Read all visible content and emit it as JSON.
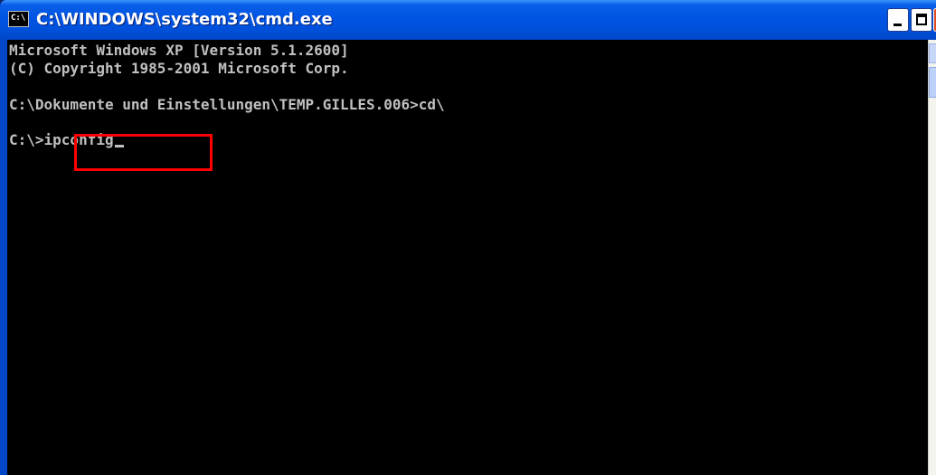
{
  "window": {
    "title": "C:\\WINDOWS\\system32\\cmd.exe",
    "icon_label": "C:\\"
  },
  "console": {
    "lines": [
      "Microsoft Windows XP [Version 5.1.2600]",
      "(C) Copyright 1985-2001 Microsoft Corp.",
      "",
      "C:\\Dokumente und Einstellungen\\TEMP.GILLES.006>cd\\",
      "",
      "C:\\>ipconfig"
    ],
    "text_color": "#c0c0c0",
    "background_color": "#000000"
  },
  "highlight": {
    "color": "#ff0000"
  },
  "icons": {
    "app": "cmd-icon",
    "minimize": "minimize-icon",
    "maximize": "maximize-icon",
    "close": "close-icon"
  }
}
